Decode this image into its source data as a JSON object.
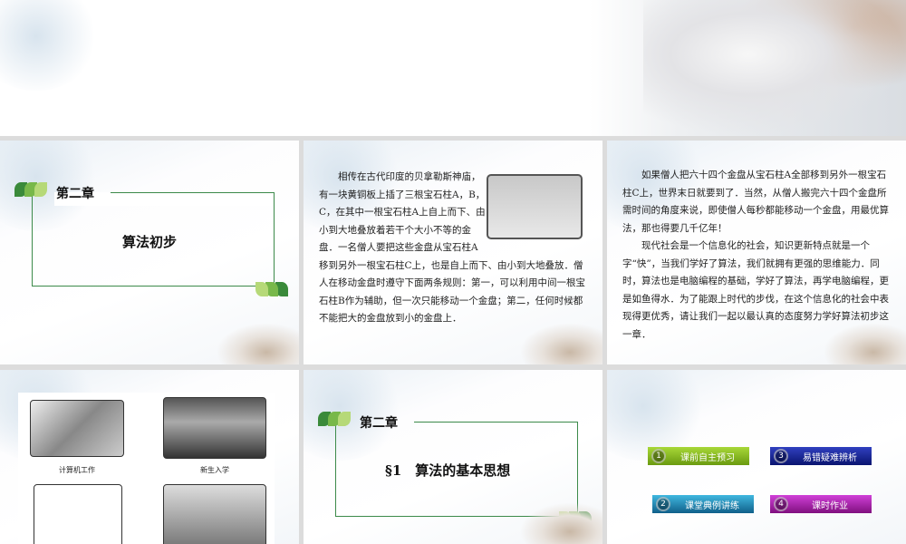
{
  "slides": {
    "s1": {
      "chapter": "第二章",
      "title": "算法初步"
    },
    "s2": {
      "paragraph": "相传在古代印度的贝拿勒斯神庙，有一块黄铜板上插了三根宝石柱A，B，C，在其中一根宝石柱A上自上而下、由小到大地叠放着若干个大小不等的金盘．一名僧人要把这些金盘从宝石柱A移到另外一根宝石柱C上，也是自上而下、由小到大地叠放．僧人在移动金盘时遵守下面两条规则：第一，可以利用中间一根宝石柱B作为辅助，但一次只能移动一个金盘；第二，任何时候都不能把大的金盘放到小的金盘上．"
    },
    "s3": {
      "paragraph1": "如果僧人把六十四个金盘从宝石柱A全部移到另外一根宝石柱C上，世界末日就要到了．当然，从僧人搬完六十四个金盘所需时间的角度来说，即使僧人每秒都能移动一个金盘，用最优算法，那也得要几千亿年！",
      "paragraph2": "现代社会是一个信息化的社会，知识更新特点就是一个字“快”，当我们学好了算法，我们就拥有更强的思维能力．同时，算法也是电脑编程的基础，学好了算法，再学电脑编程，更是如鱼得水．为了能跟上时代的步伐，在这个信息化的社会中表现得更优秀，请让我们一起以最认真的态度努力学好算法初步这一章．"
    },
    "s4": {
      "captions": [
        "计算机工作",
        "新生入学"
      ]
    },
    "s5": {
      "chapter": "第二章",
      "section": "§1　算法的基本思想"
    },
    "s6": {
      "buttons": [
        {
          "num": "1",
          "label": "课前自主预习",
          "color": "#8cc21e"
        },
        {
          "num": "2",
          "label": "课堂典例讲练",
          "color": "#1a8fc0"
        },
        {
          "num": "3",
          "label": "易错疑难辨析",
          "color": "#1a2aa0"
        },
        {
          "num": "4",
          "label": "课时作业",
          "color": "#b01ab8"
        }
      ]
    }
  }
}
